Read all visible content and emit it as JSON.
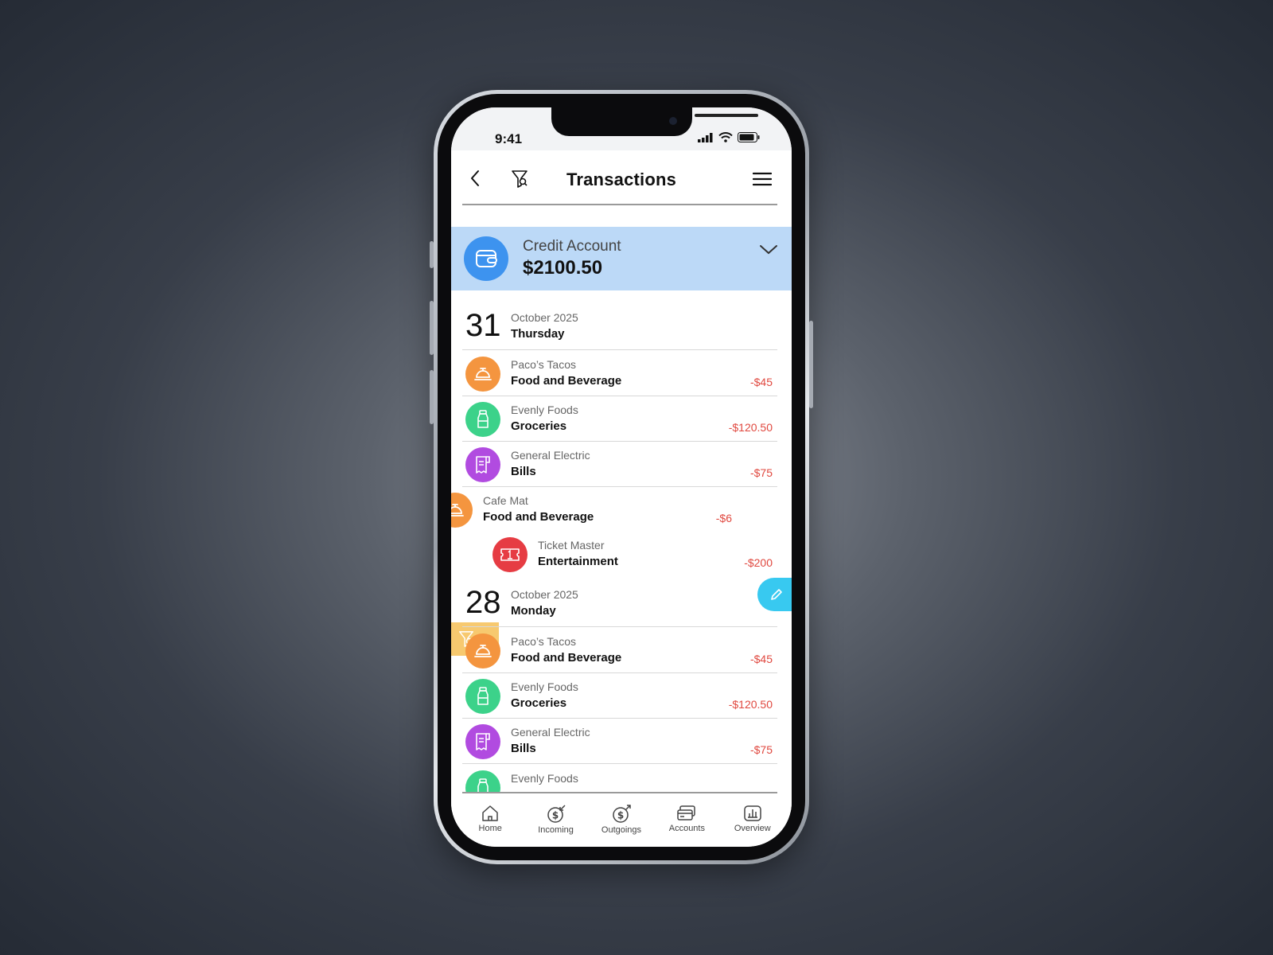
{
  "status_bar": {
    "time": "9:41"
  },
  "header": {
    "title": "Transactions"
  },
  "account": {
    "name": "Credit Account",
    "balance": "$2100.50"
  },
  "groups": [
    {
      "day": "31",
      "month": "October 2025",
      "weekday": "Thursday",
      "transactions": [
        {
          "merchant": "Paco’s Tacos",
          "category": "Food and Beverage",
          "amount": "-$45",
          "icon": "bell-icon",
          "color": "#f4953f"
        },
        {
          "merchant": "Evenly Foods",
          "category": "Groceries",
          "amount": "-$120.50",
          "icon": "bottle-icon",
          "color": "#3cd28a"
        },
        {
          "merchant": "General Electric",
          "category": "Bills",
          "amount": "-$75",
          "icon": "receipt-icon",
          "color": "#b14be0"
        },
        {
          "merchant": "Cafe Mat",
          "category": "Food and Beverage",
          "amount": "-$6",
          "icon": "bell-icon",
          "color": "#f4953f"
        },
        {
          "merchant": "Ticket Master",
          "category": "Entertainment",
          "amount": "-$200",
          "icon": "ticket-icon",
          "color": "#e63c43"
        }
      ]
    },
    {
      "day": "28",
      "month": "October 2025",
      "weekday": "Monday",
      "transactions": [
        {
          "merchant": "Paco’s Tacos",
          "category": "Food and Beverage",
          "amount": "-$45",
          "icon": "bell-icon",
          "color": "#f4953f"
        },
        {
          "merchant": "Evenly Foods",
          "category": "Groceries",
          "amount": "-$120.50",
          "icon": "bottle-icon",
          "color": "#3cd28a"
        },
        {
          "merchant": "General Electric",
          "category": "Bills",
          "amount": "-$75",
          "icon": "receipt-icon",
          "color": "#b14be0"
        },
        {
          "merchant": "Evenly Foods",
          "icon": "bottle-icon",
          "color": "#3cd28a"
        }
      ]
    }
  ],
  "tabs": [
    {
      "label": "Home",
      "icon": "home-icon"
    },
    {
      "label": "Incoming",
      "icon": "incoming-dollar-icon"
    },
    {
      "label": "Outgoings",
      "icon": "outgoing-dollar-icon"
    },
    {
      "label": "Accounts",
      "icon": "cards-icon"
    },
    {
      "label": "Overview",
      "icon": "chart-icon"
    }
  ],
  "colors": {
    "accent": "#3d93ef",
    "account_bg": "#bcd9f7",
    "negative": "#e0483f",
    "edit_action": "#38c9f0",
    "filter_action": "#f7c96f"
  }
}
